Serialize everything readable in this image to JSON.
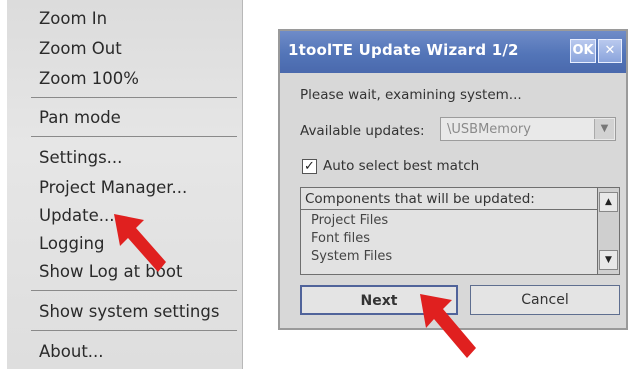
{
  "context_menu": {
    "items": [
      {
        "label": "Zoom In"
      },
      {
        "label": "Zoom Out"
      },
      {
        "label": "Zoom 100%"
      },
      {
        "label": "Pan mode"
      },
      {
        "label": "Settings..."
      },
      {
        "label": "Project Manager..."
      },
      {
        "label": "Update..."
      },
      {
        "label": "Logging"
      },
      {
        "label": "Show Log at boot"
      },
      {
        "label": "Show system settings"
      },
      {
        "label": "About..."
      }
    ]
  },
  "dialog": {
    "title": "1toolTE Update Wizard 1/2",
    "ok_label": "OK",
    "close_label": "✕",
    "status_text": "Please wait, examining system...",
    "available_updates_label": "Available updates:",
    "available_updates_value": "\\USBMemory",
    "auto_select_label": "Auto select best match",
    "auto_select_checked": true,
    "components_header": "Components that will be updated:",
    "components": [
      "Project Files",
      "Font files",
      "System Files"
    ],
    "next_label": "Next",
    "cancel_label": "Cancel"
  },
  "colors": {
    "titlebar": "#5375b8",
    "arrow": "#e0201f"
  },
  "icons": {
    "scroll_up": "triangle-up-icon",
    "scroll_down": "triangle-down-icon",
    "dropdown": "chevron-down-icon",
    "pointer": "red-arrow-icon"
  }
}
